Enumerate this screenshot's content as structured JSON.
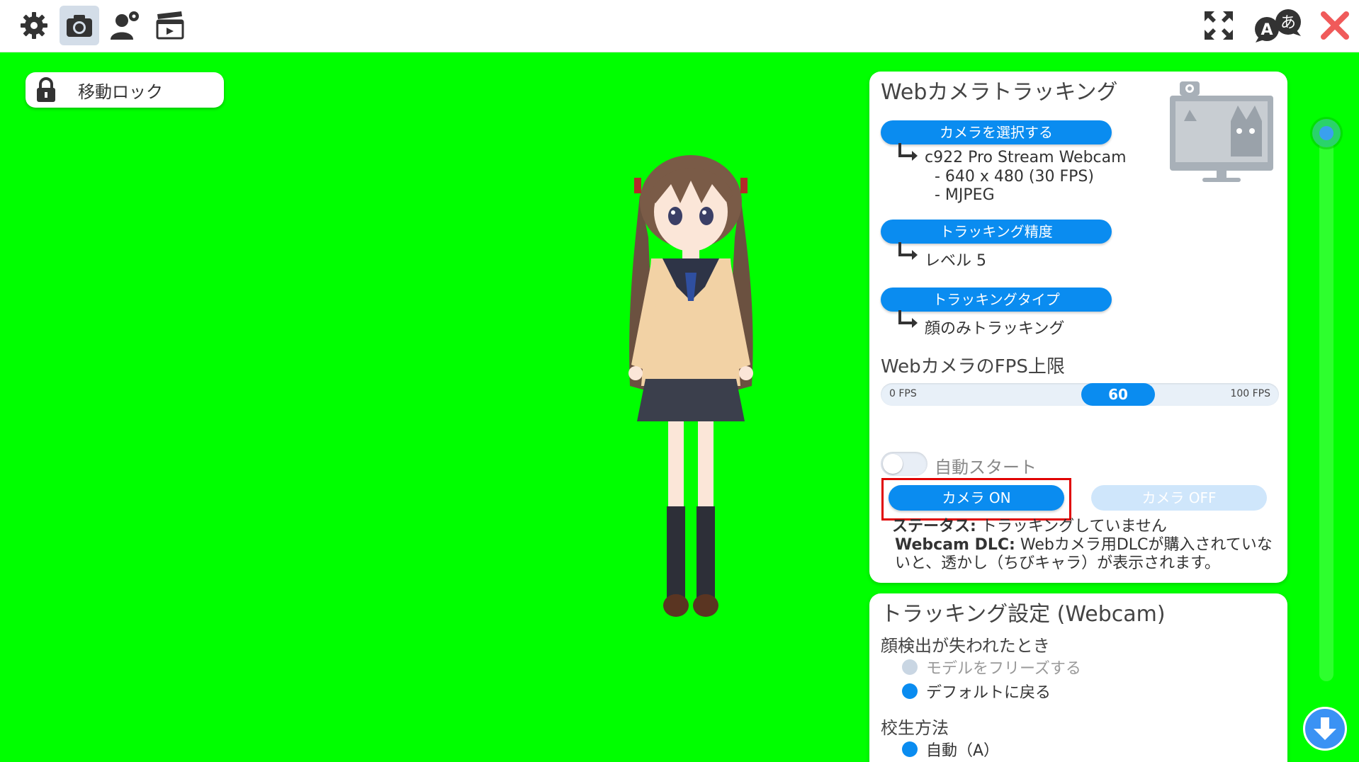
{
  "toolbar": {
    "left_icons": [
      "gear-icon",
      "camera-icon",
      "user-settings-icon",
      "clapperboard-icon"
    ],
    "active_icon": "camera-icon",
    "right_icons": [
      "fullscreen-icon",
      "language-icon",
      "close-icon"
    ],
    "language_icon_text": "あ",
    "language_icon_letter": "A"
  },
  "lock_button": {
    "label": "移動ロック"
  },
  "webcam_panel": {
    "title": "Webカメラトラッキング",
    "select_camera_label": "カメラを選択する",
    "camera_name": "c922 Pro Stream Webcam",
    "camera_resolution": "- 640 x 480 (30 FPS)",
    "camera_format": "- MJPEG",
    "accuracy_label": "トラッキング精度",
    "accuracy_value": "レベル 5",
    "type_label": "トラッキングタイプ",
    "type_value": "顔のみトラッキング",
    "fps_title": "WebカメラのFPS上限",
    "fps_min_label": "0 FPS",
    "fps_max_label": "100 FPS",
    "fps_value": "60",
    "fps_min": 0,
    "fps_max": 100,
    "auto_start_label": "自動スタート",
    "auto_start_on": false,
    "camera_on_label": "カメラ ON",
    "camera_off_label": "カメラ OFF",
    "status_key": "ステータス:",
    "status_value": "トラッキングしていません",
    "dlc_key": "Webcam DLC:",
    "dlc_value": "Webカメラ用DLCが購入されていないと、透かし（ちびキャラ）が表示されます。"
  },
  "tracking_settings": {
    "title": "トラッキング設定 (Webcam)",
    "face_lost_label": "顔検出が失われたとき",
    "face_lost_options": [
      {
        "label": "モデルをフリーズする",
        "selected": false
      },
      {
        "label": "デフォルトに戻る",
        "selected": true
      }
    ],
    "calibration_label": "校生方法",
    "calibration_options": [
      {
        "label": "自動（A）",
        "selected": true
      }
    ]
  },
  "colors": {
    "background": "#00ff00",
    "accent": "#0a8cf0",
    "close": "#f05a5a",
    "highlight": "#e00000"
  }
}
